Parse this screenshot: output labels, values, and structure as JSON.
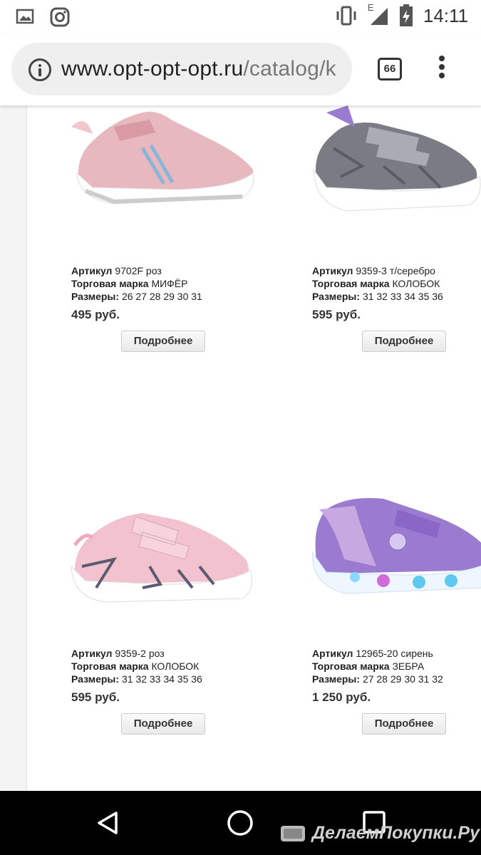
{
  "status": {
    "time": "14:11",
    "network": "E"
  },
  "browser": {
    "url_main": "www.opt-opt-opt.ru",
    "url_rest": "/catalog/k",
    "tab_count": "66"
  },
  "products": [
    {
      "article_label": "Артикул",
      "article": "9702F роз",
      "brand_label": "Торговая марка",
      "brand": "МИФЁР",
      "sizes_label": "Размеры:",
      "sizes": "26 27 28 29 30 31",
      "price": "495 руб.",
      "button": "Подробнее",
      "color": "#e8b8bf"
    },
    {
      "article_label": "Артикул",
      "article": "9359-3 т/серебро",
      "brand_label": "Торговая марка",
      "brand": "КОЛОБОК",
      "sizes_label": "Размеры:",
      "sizes": "31 32 33 34 35 36",
      "price": "595 руб.",
      "button": "Подробнее",
      "color": "#7a7b85"
    },
    {
      "article_label": "Артикул",
      "article": "9359-2 роз",
      "brand_label": "Торговая марка",
      "brand": "КОЛОБОК",
      "sizes_label": "Размеры:",
      "sizes": "31 32 33 34 35 36",
      "price": "595 руб.",
      "button": "Подробнее",
      "color": "#f2c2ce"
    },
    {
      "article_label": "Артикул",
      "article": "12965-20 сирень",
      "brand_label": "Торговая марка",
      "brand": "ЗЕБРА",
      "sizes_label": "Размеры:",
      "sizes": "27 28 29 30 31 32",
      "price": "1 250 руб.",
      "button": "Подробнее",
      "color": "#9a7bd0"
    }
  ],
  "watermark": "ДелаемПокупки.Ру"
}
